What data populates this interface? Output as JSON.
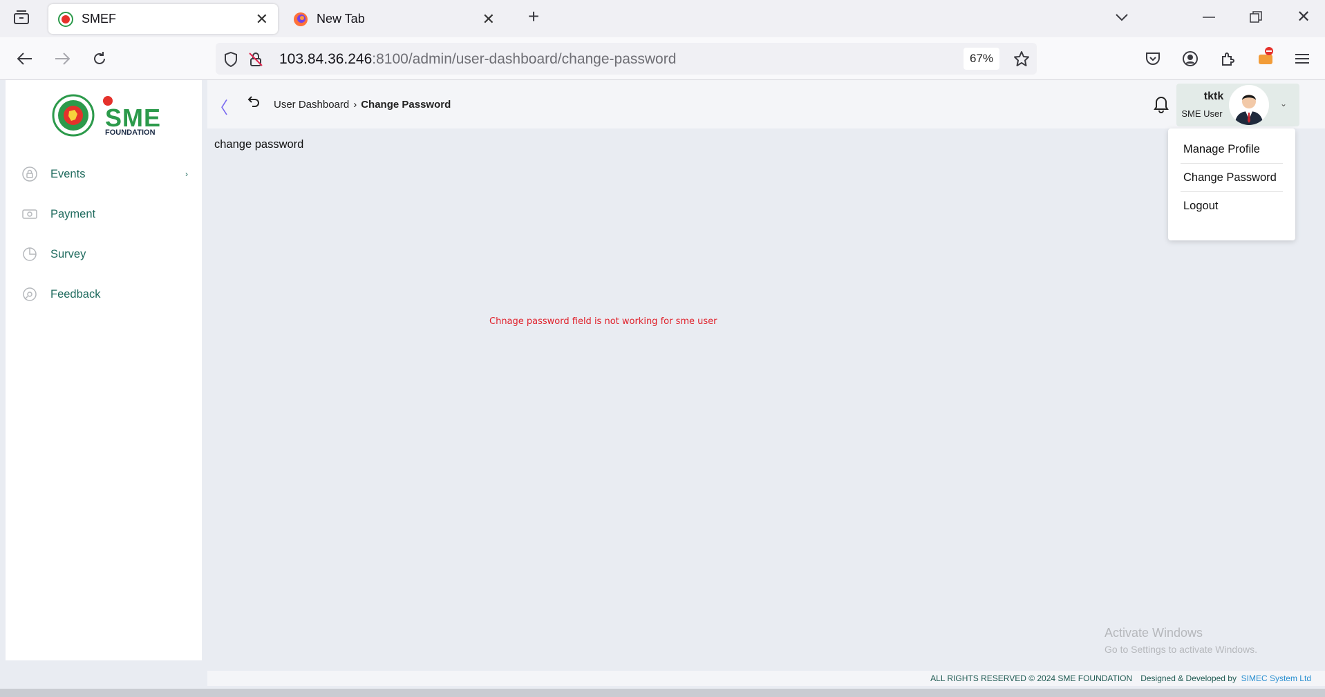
{
  "browser": {
    "tabs": [
      {
        "title": "SMEF",
        "active": true
      },
      {
        "title": "New Tab",
        "active": false
      }
    ],
    "url": {
      "host": "103.84.36.246",
      "rest": ":8100/admin/user-dashboard/change-password"
    },
    "zoom": "67%"
  },
  "sidebar": {
    "logo_text": "FOUNDATION",
    "logo_letters": "SME",
    "items": [
      {
        "label": "Events",
        "icon": "lock-circle-icon",
        "has_submenu": true
      },
      {
        "label": "Payment",
        "icon": "banknote-icon",
        "has_submenu": false
      },
      {
        "label": "Survey",
        "icon": "pie-chart-icon",
        "has_submenu": false
      },
      {
        "label": "Feedback",
        "icon": "feedback-icon",
        "has_submenu": false
      }
    ]
  },
  "header": {
    "breadcrumb_parent": "User Dashboard",
    "breadcrumb_current": "Change Password",
    "user_name": "tktk",
    "user_role": "SME User"
  },
  "dropdown": {
    "items": [
      "Manage Profile",
      "Change Password",
      "Logout"
    ]
  },
  "content": {
    "page_title": "change password",
    "note": "Chnage password field is not working for sme user"
  },
  "watermark": {
    "line1": "Activate Windows",
    "line2": "Go to Settings to activate Windows."
  },
  "footer": {
    "rights": "ALL RIGHTS RESERVED © 2024 SME FOUNDATION",
    "designed": "Designed & Developed by",
    "developer": "SIMEC System Ltd"
  },
  "colors": {
    "accent_green": "#1f6b5e",
    "error_red": "#e0202a",
    "collapse_purple": "#7b6cf0"
  }
}
